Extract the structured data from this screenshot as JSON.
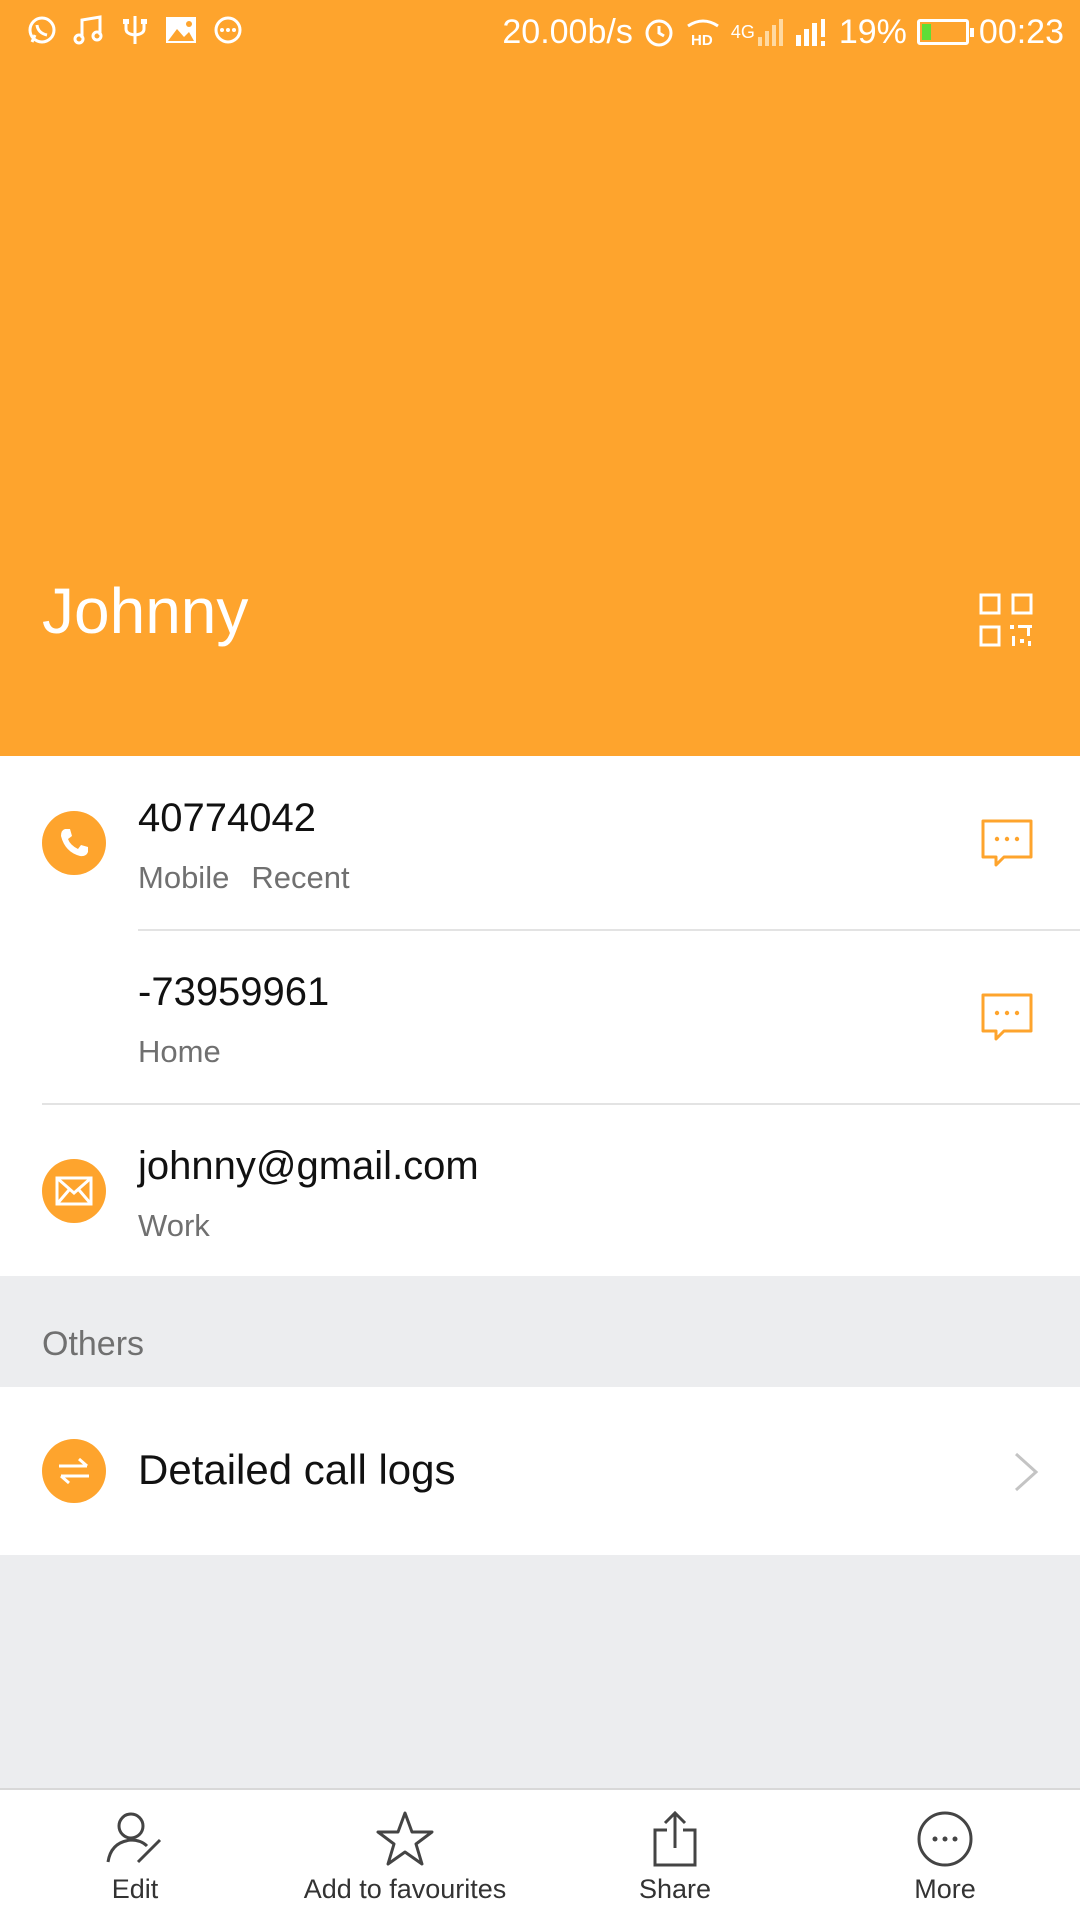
{
  "status_bar": {
    "left_icons": [
      "whatsapp-icon",
      "music-icon",
      "usb-icon",
      "image-icon",
      "more-notifications-icon"
    ],
    "speed": "20.00b/s",
    "network_4g": "4G",
    "battery": "19%",
    "battery_level": 0.19,
    "time": "00:23"
  },
  "contact": {
    "name": "Johnny",
    "phones": [
      {
        "number": "40774042",
        "type": "Mobile",
        "tag": "Recent"
      },
      {
        "number": "-73959961",
        "type": "Home"
      }
    ],
    "email": {
      "address": "johnny@gmail.com",
      "type": "Work"
    }
  },
  "others": {
    "section_title": "Others",
    "call_logs_label": "Detailed call logs"
  },
  "toolbar": {
    "edit": "Edit",
    "favourite": "Add to favourites",
    "share": "Share",
    "more": "More"
  },
  "colors": {
    "accent": "#fea42d",
    "background": "#ecedef"
  }
}
